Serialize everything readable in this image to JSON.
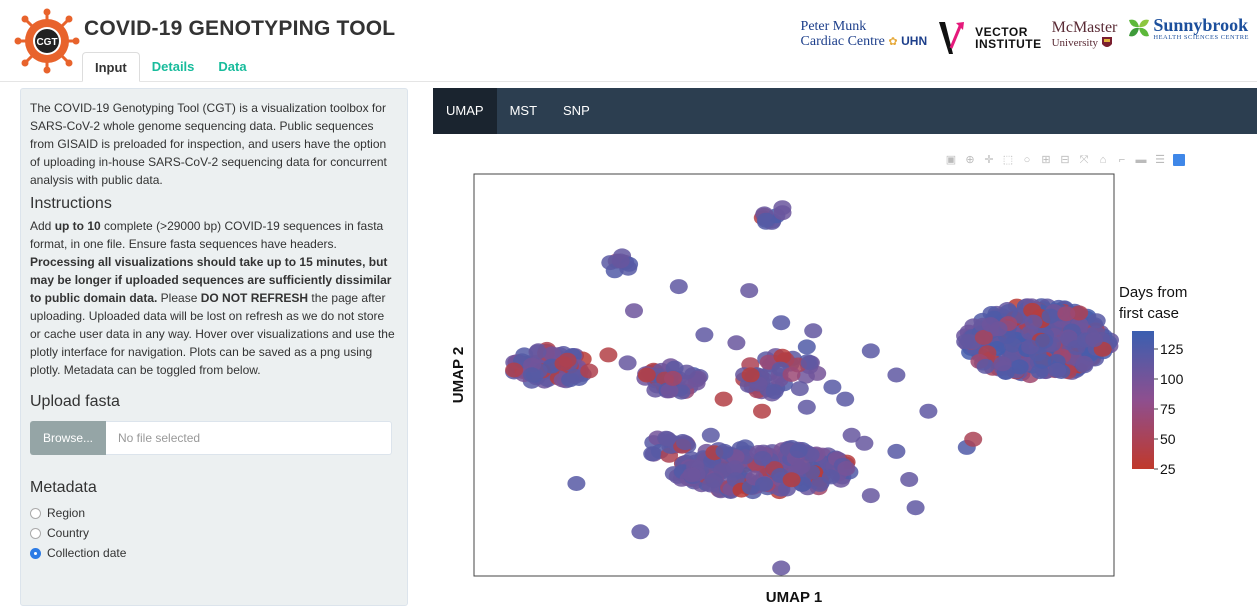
{
  "app": {
    "title": "COVID-19 GENOTYPING TOOL",
    "logo_text": "CGT",
    "tabs": [
      {
        "label": "Input",
        "active": true
      },
      {
        "label": "Details",
        "active": false
      },
      {
        "label": "Data",
        "active": false
      }
    ]
  },
  "partners": {
    "pmcc_line1": "Peter Munk",
    "pmcc_line2": "Cardiac Centre",
    "uhn": "UHN",
    "vector_line1": "VECTOR",
    "vector_line2": "INSTITUTE",
    "mcmaster_line1": "McMaster",
    "mcmaster_line2": "University",
    "sunnybrook_line1": "Sunnybrook",
    "sunnybrook_line2": "HEALTH SCIENCES CENTRE"
  },
  "sidebar": {
    "intro": "The COVID-19 Genotyping Tool (CGT) is a visualization toolbox for SARS-CoV-2 whole genome sequencing data. Public sequences from GISAID is preloaded for inspection, and users have the option of uploading in-house SARS-CoV-2 sequencing data for concurrent analysis with public data.",
    "instructions_heading": "Instructions",
    "instr": {
      "t1": "Add ",
      "b1": "up to 10",
      "t2": " complete (>29000 bp) COVID-19 sequences in fasta format, in one file. Ensure fasta sequences have headers. ",
      "b2": "Processing all visualizations should take up to 15 minutes, but may be longer if uploaded sequences are sufficiently dissimilar to public domain data.",
      "t3": " Please ",
      "b3": "DO NOT REFRESH",
      "t4": " the page after uploading. Uploaded data will be lost on refresh as we do not store or cache user data in any way. Hover over visualizations and use the plotly interface for navigation. Plots can be saved as a png using plotly. Metadata can be toggled from below."
    },
    "upload_heading": "Upload fasta",
    "browse_label": "Browse...",
    "file_placeholder": "No file selected",
    "metadata_heading": "Metadata",
    "metadata_options": [
      {
        "label": "Region",
        "checked": false
      },
      {
        "label": "Country",
        "checked": false
      },
      {
        "label": "Collection date",
        "checked": true
      }
    ]
  },
  "main": {
    "nav_tabs": [
      {
        "label": "UMAP",
        "active": true
      },
      {
        "label": "MST",
        "active": false
      },
      {
        "label": "SNP",
        "active": false
      }
    ]
  },
  "colors": {
    "accent": "#18bc9c",
    "navbar": "#2c3e50",
    "navbar_active": "#1a242f",
    "sidebar_bg": "#ecf0f1",
    "low": "#c0392b",
    "mid": "#8e4f8f",
    "high": "#3a5fb0"
  },
  "chart_data": {
    "type": "scatter",
    "xlabel": "UMAP 1",
    "ylabel": "UMAP 2",
    "colorbar_title_line1": "Days from",
    "colorbar_title_line2": "first case",
    "colorbar_ticks": [
      125,
      100,
      75,
      50,
      25
    ],
    "colorbar_range": [
      25,
      140
    ],
    "legend_position": "right",
    "grid": false,
    "clusters": [
      {
        "cx": 0.47,
        "cy": 0.89,
        "rx": 0.025,
        "ry": 0.03,
        "n": 10,
        "days": 115
      },
      {
        "cx": 0.23,
        "cy": 0.77,
        "rx": 0.02,
        "ry": 0.028,
        "n": 8,
        "days": 120
      },
      {
        "cx": 0.12,
        "cy": 0.52,
        "rx": 0.06,
        "ry": 0.045,
        "n": 80,
        "days": 110
      },
      {
        "cx": 0.88,
        "cy": 0.585,
        "rx": 0.115,
        "ry": 0.09,
        "n": 350,
        "days": 118
      },
      {
        "cx": 0.31,
        "cy": 0.49,
        "rx": 0.045,
        "ry": 0.035,
        "n": 45,
        "days": 115
      },
      {
        "cx": 0.48,
        "cy": 0.5,
        "rx": 0.06,
        "ry": 0.05,
        "n": 45,
        "days": 112
      },
      {
        "cx": 0.45,
        "cy": 0.265,
        "rx": 0.14,
        "ry": 0.06,
        "n": 220,
        "days": 110
      },
      {
        "cx": 0.3,
        "cy": 0.32,
        "rx": 0.04,
        "ry": 0.025,
        "n": 20,
        "days": 110
      }
    ],
    "scattered": [
      [
        0.32,
        0.72,
        115
      ],
      [
        0.25,
        0.66,
        105
      ],
      [
        0.43,
        0.71,
        110
      ],
      [
        0.48,
        0.63,
        120
      ],
      [
        0.53,
        0.61,
        112
      ],
      [
        0.41,
        0.58,
        108
      ],
      [
        0.52,
        0.57,
        125
      ],
      [
        0.36,
        0.6,
        115
      ],
      [
        0.21,
        0.55,
        40
      ],
      [
        0.24,
        0.53,
        110
      ],
      [
        0.62,
        0.56,
        118
      ],
      [
        0.66,
        0.5,
        115
      ],
      [
        0.56,
        0.47,
        120
      ],
      [
        0.45,
        0.41,
        40
      ],
      [
        0.52,
        0.42,
        115
      ],
      [
        0.58,
        0.44,
        118
      ],
      [
        0.71,
        0.41,
        115
      ],
      [
        0.61,
        0.33,
        110
      ],
      [
        0.66,
        0.31,
        120
      ],
      [
        0.68,
        0.24,
        112
      ],
      [
        0.77,
        0.32,
        125
      ],
      [
        0.78,
        0.34,
        50
      ],
      [
        0.62,
        0.2,
        110
      ],
      [
        0.16,
        0.23,
        120
      ],
      [
        0.26,
        0.11,
        115
      ],
      [
        0.48,
        0.02,
        110
      ],
      [
        0.69,
        0.17,
        115
      ],
      [
        0.37,
        0.35,
        118
      ],
      [
        0.39,
        0.44,
        40
      ],
      [
        0.18,
        0.51,
        45
      ],
      [
        0.59,
        0.35,
        110
      ],
      [
        0.27,
        0.5,
        38
      ]
    ]
  }
}
